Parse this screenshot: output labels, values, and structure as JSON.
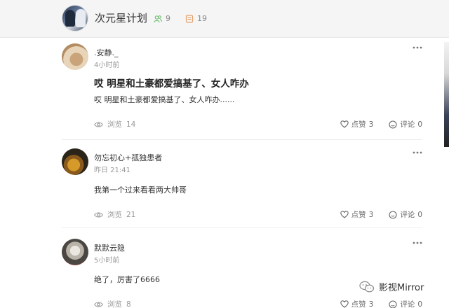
{
  "header": {
    "group_name": "次元星计划",
    "member_count": "9",
    "post_count": "19"
  },
  "posts": [
    {
      "author": ".安静._",
      "time": "4小时前",
      "title": "哎 明星和土豪都爱搞基了、女人咋办",
      "content": "哎 明星和土豪都爱搞基了、女人咋办......",
      "views_label": "浏览",
      "views": "14",
      "likes_label": "点赞",
      "likes": "3",
      "comments_label": "评论",
      "comments": "0"
    },
    {
      "author": "勿忘初心+孤独患者",
      "time": "昨日 21:41",
      "title": "",
      "content": "我第一个过来看看两大帅哥",
      "views_label": "浏览",
      "views": "21",
      "likes_label": "点赞",
      "likes": "3",
      "comments_label": "评论",
      "comments": "0"
    },
    {
      "author": "默默云隐",
      "time": "5小时前",
      "title": "",
      "content": "绝了，厉害了6666",
      "views_label": "浏览",
      "views": "8",
      "likes_label": "点赞",
      "likes": "3",
      "comments_label": "评论",
      "comments": "0"
    }
  ],
  "watermark": {
    "text": "影视Mirror"
  },
  "icons": {
    "members": "people-icon",
    "posts": "document-icon",
    "views": "eye-icon",
    "likes": "heart-icon",
    "comments": "smile-comment-icon",
    "more": "more-dots-icon",
    "watermark": "wechat-icon"
  },
  "colors": {
    "header_bg": "#f5f5f5",
    "members_icon": "#6fbf73",
    "posts_icon": "#e8a06a"
  }
}
